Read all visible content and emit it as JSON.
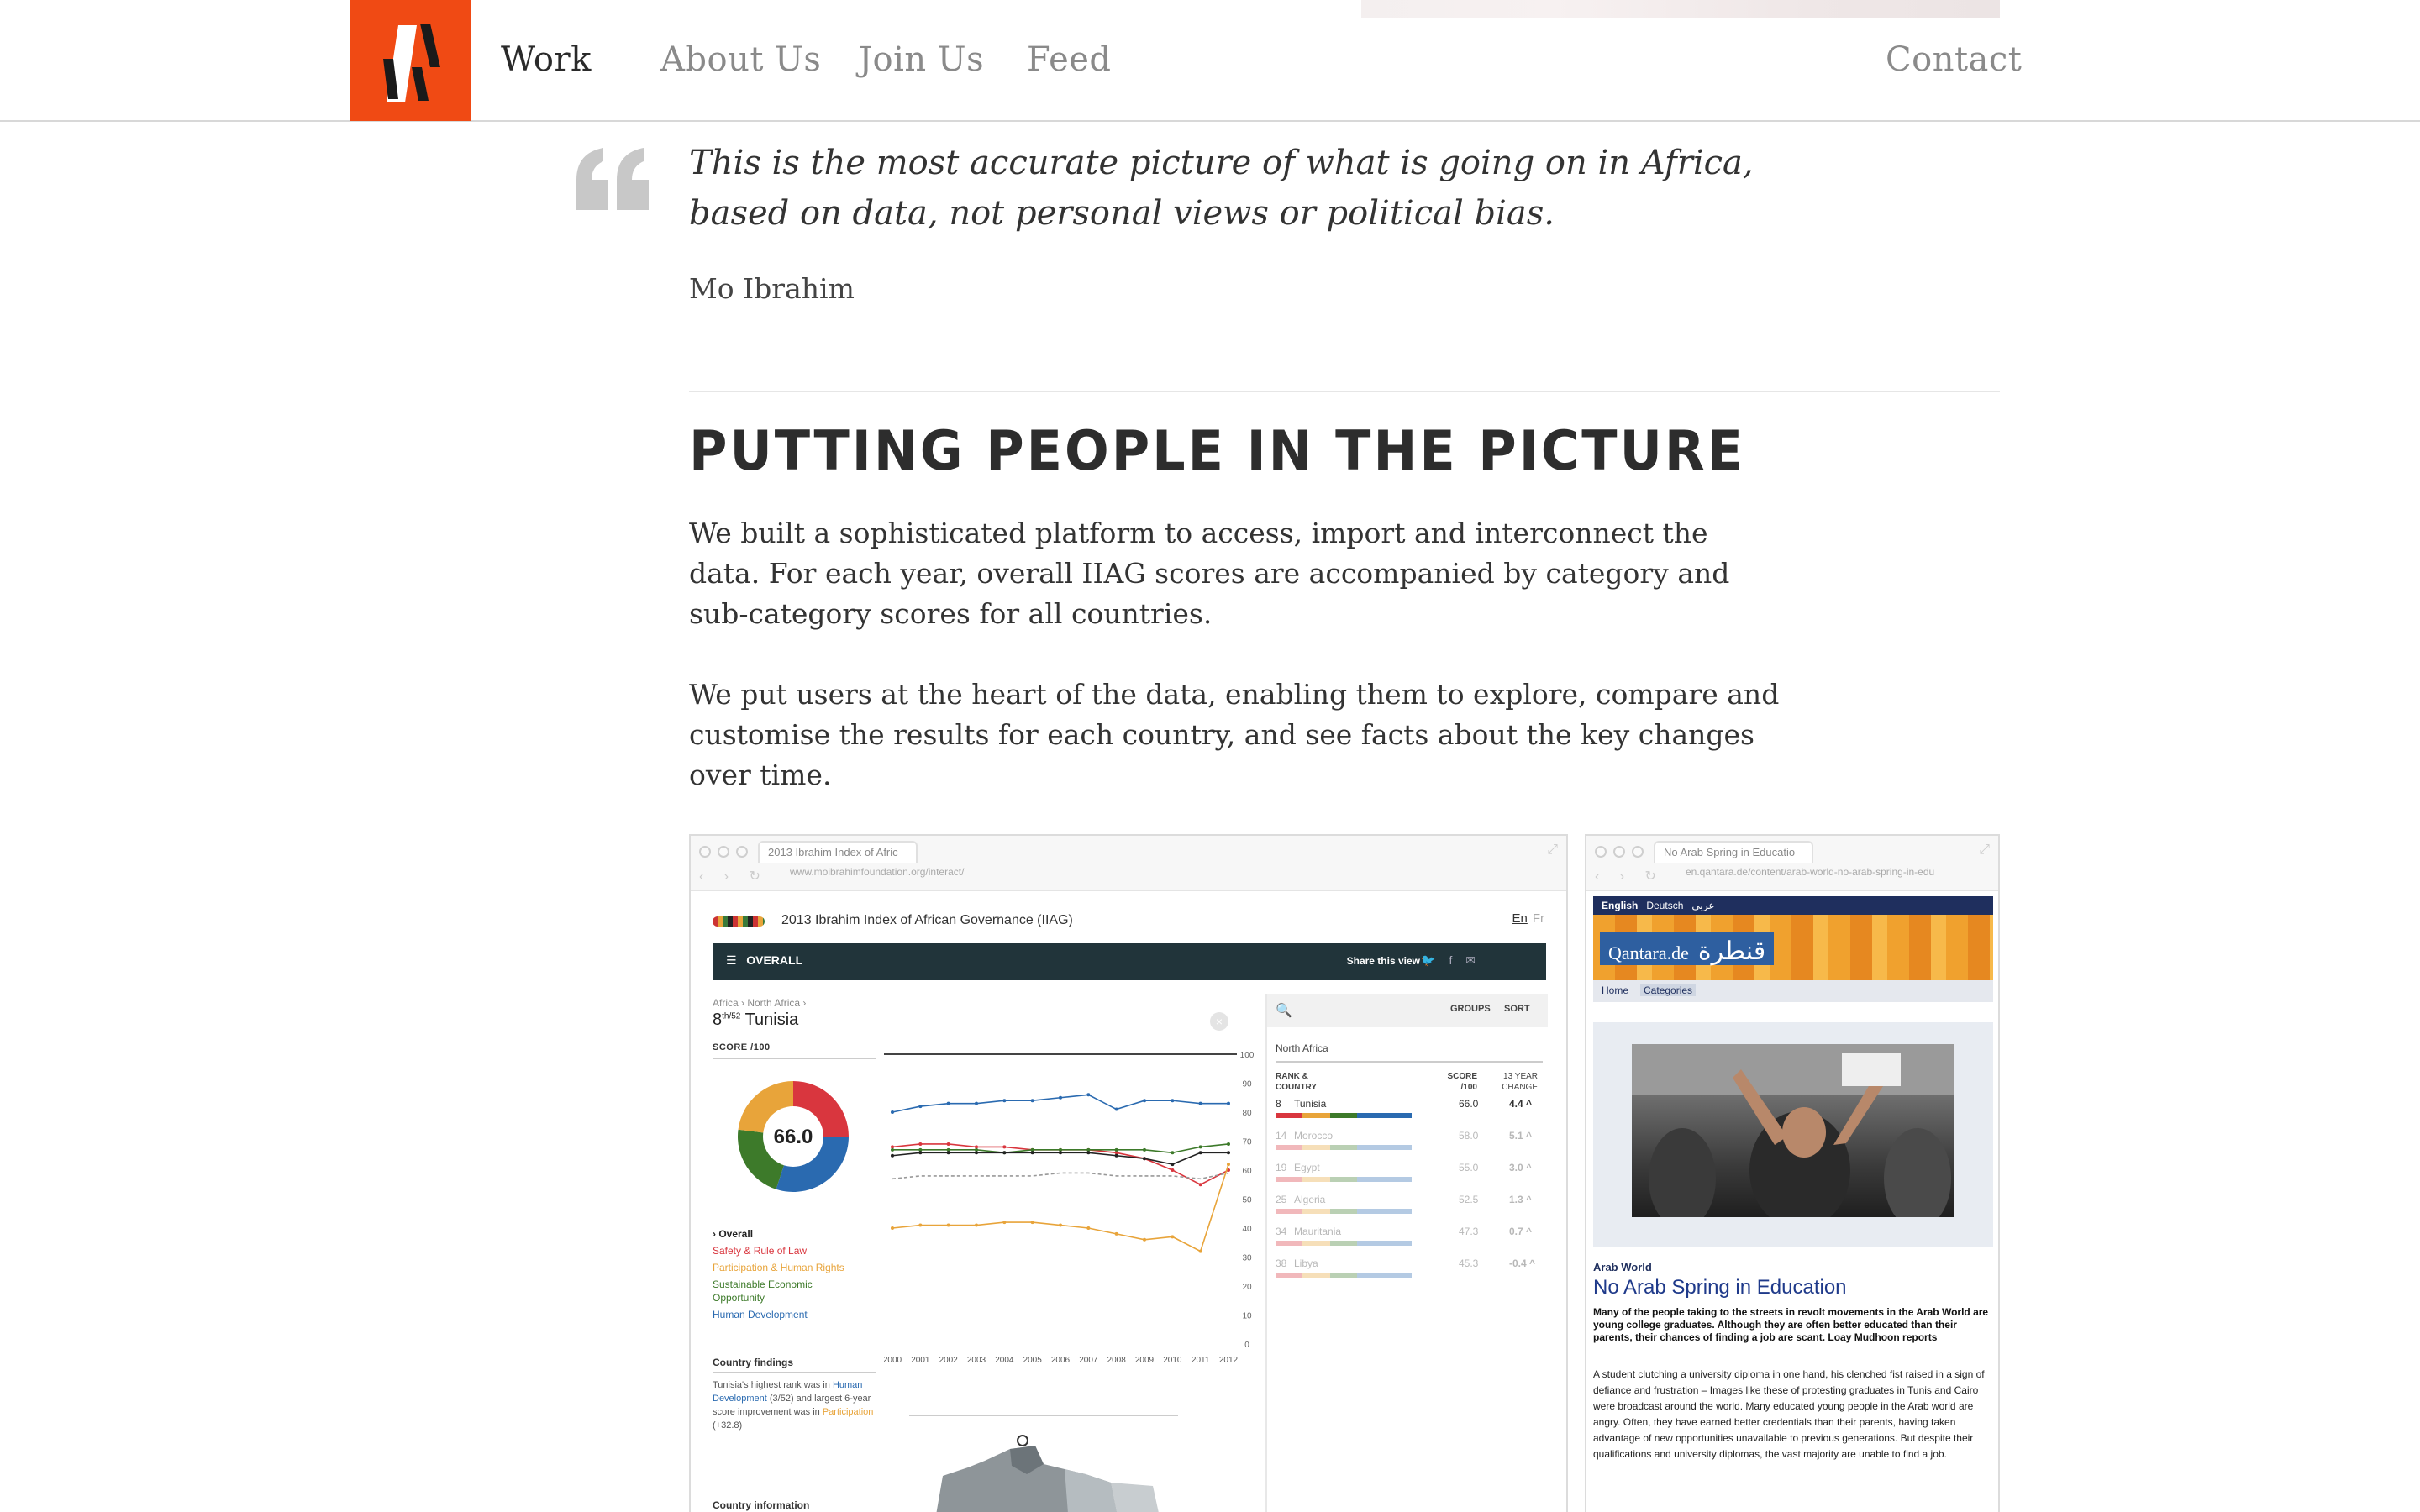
{
  "header": {
    "logo_alt": "VA logo",
    "nav": [
      {
        "label": "Work",
        "active": true
      },
      {
        "label": "About Us",
        "active": false
      },
      {
        "label": "Join Us",
        "active": false
      },
      {
        "label": "Feed",
        "active": false
      }
    ],
    "contact_label": "Contact"
  },
  "quote": {
    "text": "This is the most accurate picture of what is going on in Africa, based on data, not personal views or political bias.",
    "author": "Mo Ibrahim"
  },
  "section": {
    "title": "Putting people in the picture",
    "paragraphs": [
      "We built a sophisticated platform to access, import and interconnect the data. For each year, overall IIAG scores are accompanied by category and sub-category scores for all countries.",
      "We put users at the heart of the data, enabling them to explore, compare and customise the results for each country, and see facts about the key changes over time."
    ]
  },
  "browser1": {
    "tab": "2013 Ibrahim Index of Afric",
    "url": "www.moibrahimfoundation.org/interact/",
    "app_title": "2013 Ibrahim Index of African Governance (IIAG)",
    "lang_en": "En",
    "lang_fr": "Fr",
    "menu_label": "OVERALL",
    "share_label": "Share this view",
    "crumbs": "Africa  ›  North Africa  ›",
    "rank": "8",
    "rank_of": "th/52",
    "country": "Tunisia",
    "score_label": "SCORE /100",
    "score_value": "66.0",
    "categories": {
      "overall": "› Overall",
      "safety": "Safety & Rule of Law",
      "participation": "Participation & Human Rights",
      "sustainable_1": "Sustainable Economic",
      "sustainable_2": "Opportunity",
      "human": "Human Development"
    },
    "findings_title": "Country findings",
    "findings_1": "Tunisia's highest rank was in",
    "findings_hd": "Human Development",
    "findings_2": " (3/52) and largest 6-year score improvement was in",
    "findings_pr": "Participation",
    "findings_3": " (+32.8)",
    "info_title": "Country information",
    "groups_label": "GROUPS",
    "sort_label": "SORT",
    "region": "North Africa",
    "col_country_1": "RANK &",
    "col_country_2": "COUNTRY",
    "col_score_1": "SCORE",
    "col_score_2": "/100",
    "col_change_1": "13 YEAR",
    "col_change_2": "CHANGE",
    "ranking": [
      {
        "rank": "8",
        "country": "Tunisia",
        "score": "66.0",
        "change": "4.4 ^"
      },
      {
        "rank": "14",
        "country": "Morocco",
        "score": "58.0",
        "change": "5.1 ^"
      },
      {
        "rank": "19",
        "country": "Egypt",
        "score": "55.0",
        "change": "3.0 ^"
      },
      {
        "rank": "25",
        "country": "Algeria",
        "score": "52.5",
        "change": "1.3 ^"
      },
      {
        "rank": "34",
        "country": "Mauritania",
        "score": "47.3",
        "change": "0.7 ^"
      },
      {
        "rank": "38",
        "country": "Libya",
        "score": "45.3",
        "change": "-0.4 ^"
      }
    ]
  },
  "browser2": {
    "tab": "No Arab Spring in Educatio",
    "url": "en.qantara.de/content/arab-world-no-arab-spring-in-edu",
    "lang_english": "English",
    "lang_deutsch": "Deutsch",
    "lang_arabic": "عربي",
    "logo_latin": "Qantara.de",
    "logo_arabic": "قنطرة",
    "menu_home": "Home",
    "menu_categories": "Categories",
    "section": "Arab World",
    "headline": "No Arab Spring in Education",
    "lead": "Many of the people taking to the streets in revolt movements in the Arab World are young college graduates. Although they are often better educated than their parents, their chances of finding a job are scant. Loay Mudhoon reports",
    "body": "A student clutching a university diploma in one hand, his clenched fist raised in a sign of defiance and frustration – Images like these of protesting graduates in Tunis and Cairo were broadcast around the world. Many educated young people in the Arab world are angry. Often, they have earned better credentials than their parents, having taken advantage of new opportunities unavailable to previous generations. But despite their qualifications and university diplomas, the vast majority are unable to find a job."
  },
  "chart_data": {
    "type": "line",
    "x": [
      2000,
      2001,
      2002,
      2003,
      2004,
      2005,
      2006,
      2007,
      2008,
      2009,
      2010,
      2011,
      2012
    ],
    "ylim": [
      0,
      100
    ],
    "yticks": [
      0,
      10,
      20,
      30,
      40,
      50,
      60,
      70,
      80,
      90,
      100
    ],
    "series": [
      {
        "name": "Human Development",
        "color": "#2a6ab0",
        "values": [
          80,
          82,
          83,
          83,
          84,
          84,
          85,
          86,
          81,
          84,
          84,
          83,
          83
        ],
        "dashed": false
      },
      {
        "name": "Safety & Rule of Law",
        "color": "#d9363e",
        "values": [
          68,
          69,
          69,
          68,
          68,
          67,
          67,
          67,
          66,
          64,
          60,
          55,
          60
        ],
        "dashed": false
      },
      {
        "name": "Sustainable Economic Opportunity",
        "color": "#3d7a2a",
        "values": [
          67,
          67,
          67,
          67,
          66,
          67,
          67,
          67,
          67,
          67,
          66,
          68,
          69
        ],
        "dashed": false
      },
      {
        "name": "Overall",
        "color": "#222222",
        "values": [
          65,
          66,
          66,
          66,
          66,
          66,
          66,
          66,
          65,
          64,
          62,
          66,
          66
        ],
        "dashed": false
      },
      {
        "name": "Overall (trend)",
        "color": "#999999",
        "values": [
          57,
          58,
          58,
          58,
          58,
          58,
          59,
          59,
          58,
          58,
          58,
          57,
          59
        ],
        "dashed": true
      },
      {
        "name": "Participation & Human Rights",
        "color": "#e8a43a",
        "values": [
          40,
          41,
          41,
          41,
          42,
          42,
          41,
          40,
          38,
          36,
          37,
          32,
          62
        ],
        "dashed": false
      }
    ],
    "donut": [
      {
        "name": "Safety & Rule of Law",
        "color": "#d9363e",
        "value": 25
      },
      {
        "name": "Human Development",
        "color": "#2a6ab0",
        "value": 30
      },
      {
        "name": "Sustainable Economic Opportunity",
        "color": "#3d7a2a",
        "value": 22
      },
      {
        "name": "Participation & Human Rights",
        "color": "#e8a43a",
        "value": 23
      }
    ]
  },
  "colors": {
    "brand": "#f04a14",
    "dark_bar": "#21343a",
    "qantara_navy": "#1f2f5e",
    "qantara_headline": "#1f3a8a"
  }
}
